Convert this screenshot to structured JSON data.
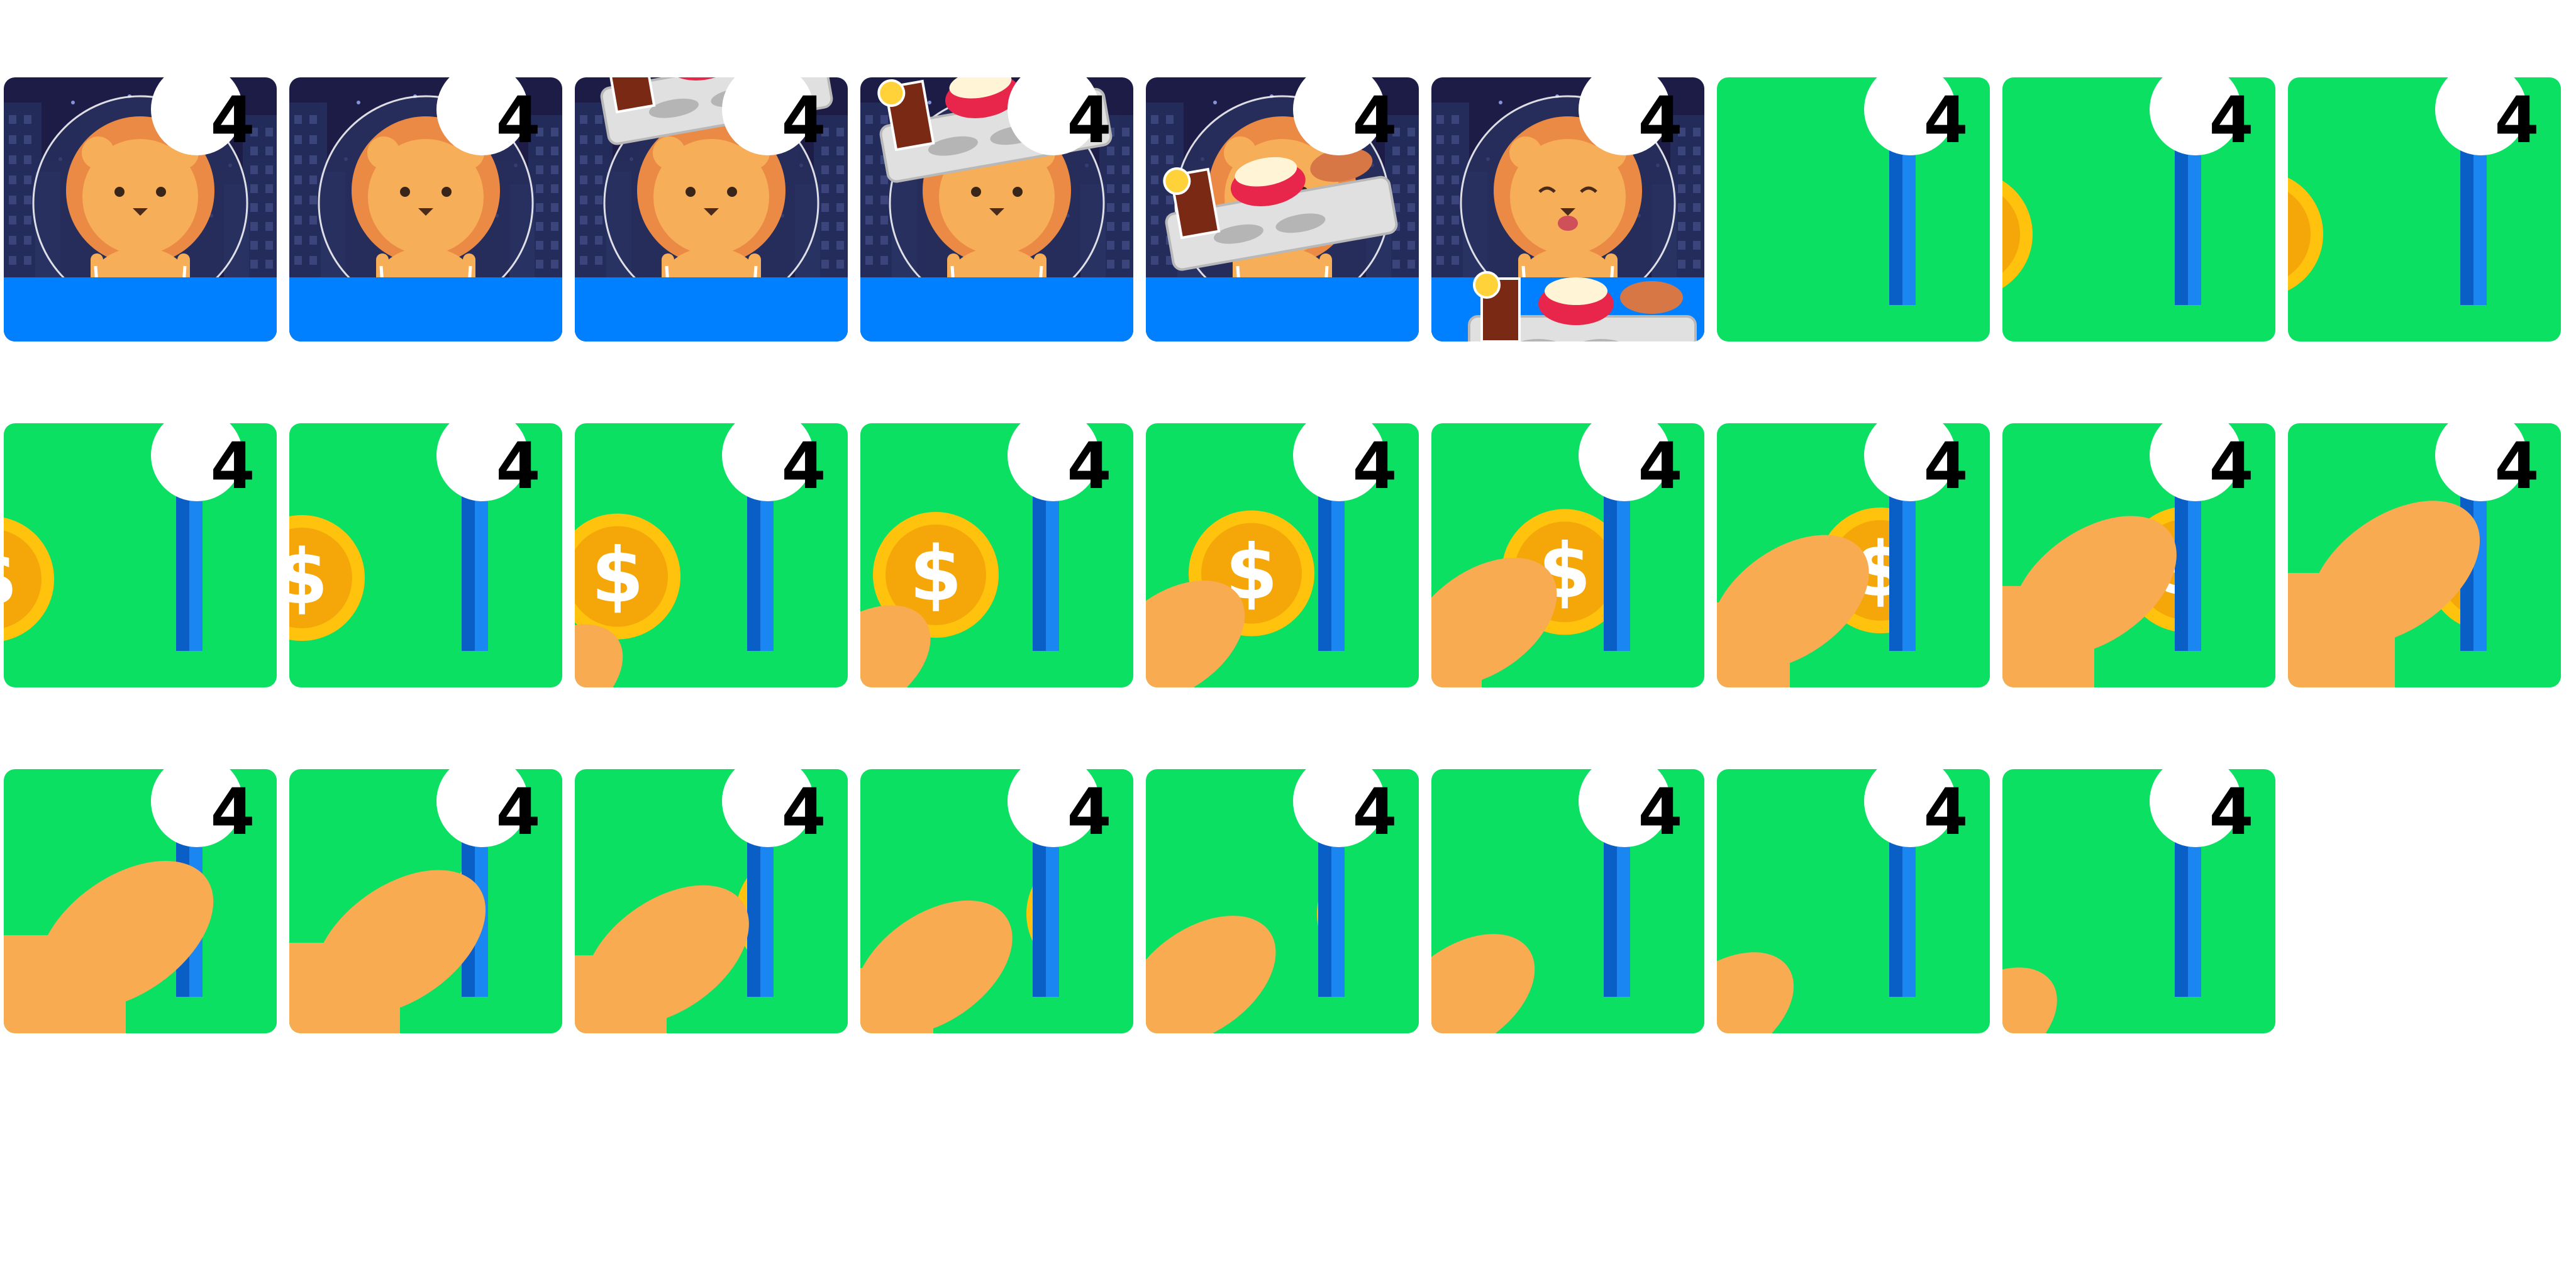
{
  "sheet": {
    "badge_number": "4",
    "colors": {
      "space": "#1c1c47",
      "table_blue": "#0080ff",
      "green": "#0be063",
      "lion": "#eb8a45",
      "lion_face": "#f7ae59",
      "coin": "#ffc20d",
      "coin_inner": "#f5a70a",
      "slot_dark": "#0a5fc7",
      "slot_light": "#1a86f2",
      "paw": "#f9ab52",
      "tray": "#e0e0e0",
      "drink": "#7a2a14",
      "bowl": "#e8254a",
      "meat": "#d77745"
    },
    "frames": [
      {
        "type": "lion"
      },
      {
        "type": "lion"
      },
      {
        "type": "lion",
        "tray": "top"
      },
      {
        "type": "lion",
        "tray": "high"
      },
      {
        "type": "lion",
        "tray": "mid"
      },
      {
        "type": "lion",
        "tray": "set",
        "happy": true
      },
      {
        "type": "coin"
      },
      {
        "type": "coin",
        "coin": 0.02
      },
      {
        "type": "coin",
        "coin": 0.04
      },
      {
        "type": "coin",
        "coin": 0.1
      },
      {
        "type": "coin",
        "coin": 0.2
      },
      {
        "type": "coin",
        "coin": 0.32,
        "paw": 0.05
      },
      {
        "type": "coin",
        "coin": 0.45,
        "paw": 0.15
      },
      {
        "type": "coin",
        "coin": 0.57,
        "paw": 0.28
      },
      {
        "type": "coin",
        "coin": 0.68,
        "paw": 0.4
      },
      {
        "type": "coin",
        "coin": 0.8,
        "paw": 0.52
      },
      {
        "type": "coin",
        "coin": 0.88,
        "paw": 0.62
      },
      {
        "type": "coin",
        "coin": 0.95,
        "paw": 0.7
      },
      {
        "type": "coin",
        "coin": 1.0,
        "paw": 0.78,
        "paw_lift": true
      },
      {
        "type": "coin",
        "coin": 1.02,
        "paw": 0.72,
        "paw_lift": true
      },
      {
        "type": "coin",
        "coin": 1.04,
        "paw": 0.62,
        "paw_lift": true
      },
      {
        "type": "coin",
        "coin": 1.06,
        "paw": 0.52,
        "paw_lift": true
      },
      {
        "type": "coin",
        "coin": 1.08,
        "paw": 0.42,
        "paw_lift": true
      },
      {
        "type": "coin",
        "coin": 1.1,
        "paw": 0.3,
        "paw_lift": true
      },
      {
        "type": "coin",
        "paw": 0.18,
        "paw_lift": true
      },
      {
        "type": "coin",
        "paw": 0.08,
        "paw_lift": true
      }
    ]
  }
}
